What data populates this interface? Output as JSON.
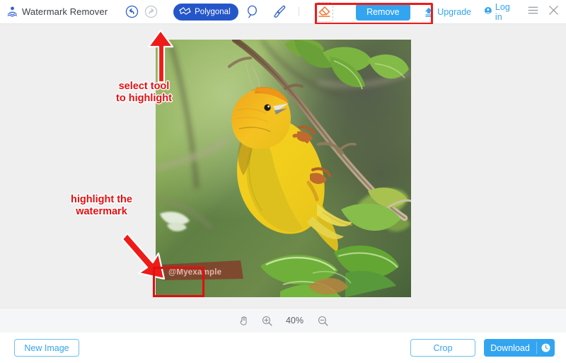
{
  "app": {
    "brand_name": "Watermark Remover",
    "brand_logo_icon": "watermark-logo-icon"
  },
  "header": {
    "history": {
      "undo_icon": "undo-arrow-icon",
      "redo_icon": "redo-arrow-icon"
    },
    "tools": [
      {
        "id": "polygonal",
        "label": "Polygonal",
        "icon": "polygonal-lasso-icon",
        "selected": true
      },
      {
        "id": "lasso",
        "label": "",
        "icon": "lasso-icon",
        "selected": false
      },
      {
        "id": "brush",
        "label": "",
        "icon": "brush-icon",
        "selected": false
      }
    ],
    "eraser": {
      "label": "",
      "icon": "eraser-icon"
    },
    "remove_label": "Remove",
    "upgrade_label": "Upgrade",
    "upgrade_icon": "upload-upgrade-icon",
    "login_label": "Log in",
    "login_icon": "user-account-icon",
    "menu_icon": "hamburger-menu-icon",
    "close_icon": "close-icon"
  },
  "canvas": {
    "annotations": [
      {
        "id": "select-tool",
        "line1": "select tool",
        "line2": "to highlight"
      },
      {
        "id": "highlight-watermark",
        "line1": "highlight the",
        "line2": "watermark"
      }
    ],
    "watermark_text": "@Myexample",
    "image_alt": "yellow bird perched on a branch with green leaves"
  },
  "zoombar": {
    "pan_icon": "hand-pan-icon",
    "zoom_in_icon": "zoom-in-icon",
    "zoom_out_icon": "zoom-out-icon",
    "zoom_level": "40%"
  },
  "footer": {
    "new_image_label": "New Image",
    "crop_label": "Crop",
    "download_label": "Download",
    "download_icon": "history-clock-icon"
  },
  "colors": {
    "accent_blue": "#33a5f0",
    "tool_blue": "#2556c9",
    "annotation_red": "#e40e10",
    "canvas_gray": "#efefef"
  }
}
